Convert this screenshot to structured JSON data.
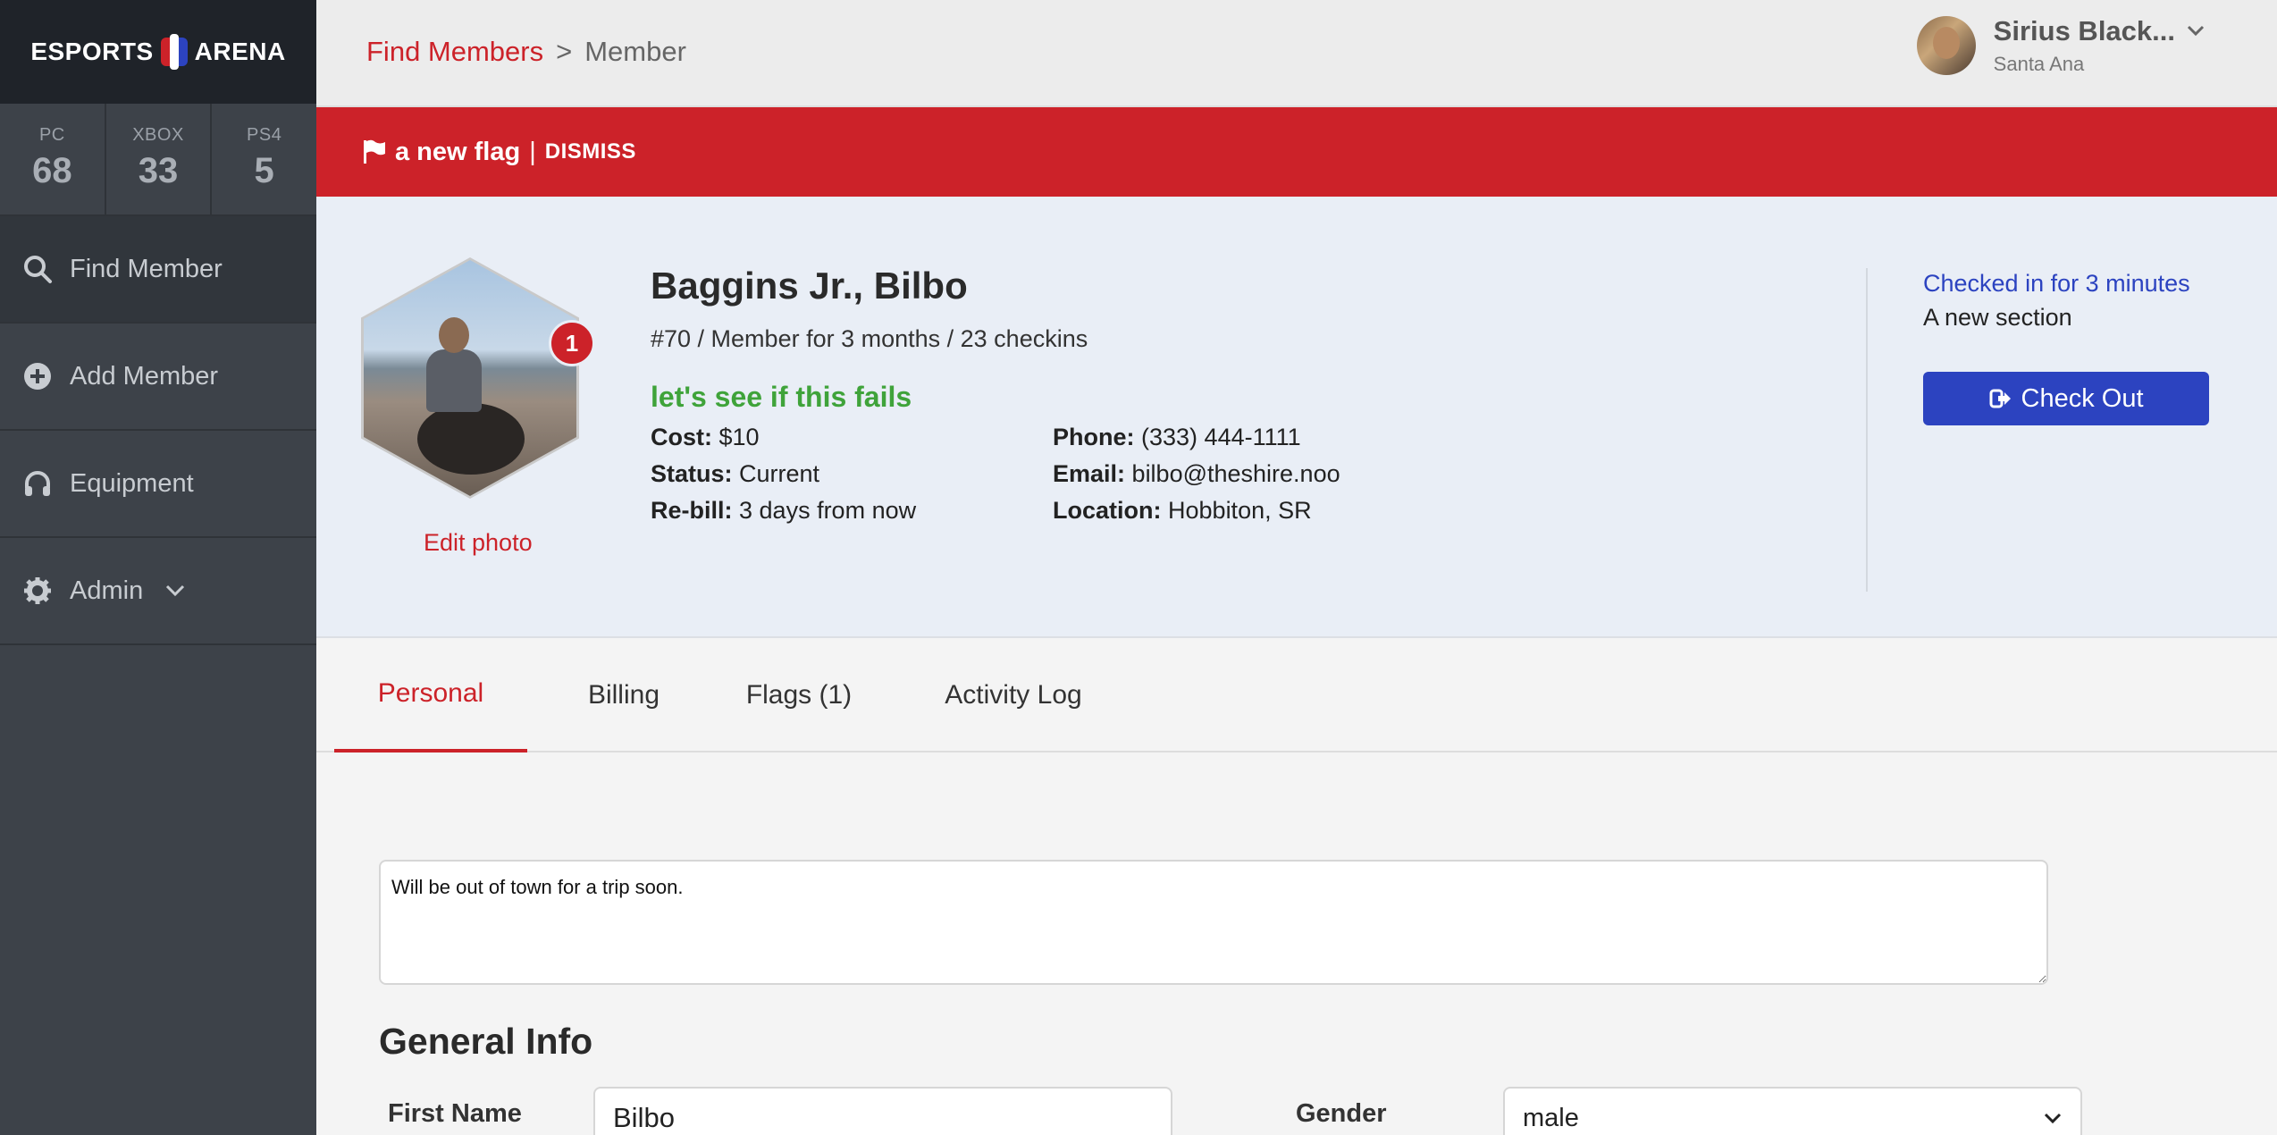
{
  "brand": {
    "left": "ESPORTS",
    "right": "ARENA"
  },
  "counts": [
    {
      "label": "PC",
      "value": "68"
    },
    {
      "label": "XBOX",
      "value": "33"
    },
    {
      "label": "PS4",
      "value": "5"
    }
  ],
  "nav": [
    {
      "label": "Find Member",
      "icon": "search-icon"
    },
    {
      "label": "Add Member",
      "icon": "plus-circle-icon"
    },
    {
      "label": "Equipment",
      "icon": "headset-icon"
    },
    {
      "label": "Admin",
      "icon": "gear-icon"
    }
  ],
  "breadcrumb": {
    "link": "Find Members",
    "sep": ">",
    "current": "Member"
  },
  "user": {
    "name": "Sirius Black...",
    "location": "Santa Ana"
  },
  "banner": {
    "text": "a new flag",
    "sep": "|",
    "dismiss": "DISMISS"
  },
  "member": {
    "name": "Baggins Jr., Bilbo",
    "summary": "#70 / Member for 3 months / 23 checkins",
    "note": "let's see if this fails",
    "flag_count": "1",
    "edit_photo": "Edit photo",
    "cost_label": "Cost:",
    "cost": "$10",
    "status_label": "Status:",
    "status": "Current",
    "rebill_label": "Re-bill:",
    "rebill": "3 days from now",
    "phone_label": "Phone:",
    "phone": "(333) 444-1111",
    "email_label": "Email:",
    "email": "bilbo@theshire.noo",
    "location_label": "Location:",
    "location": "Hobbiton, SR",
    "checked_in": "Checked in for 3 minutes",
    "section": "A new section",
    "checkout": "Check Out"
  },
  "tabs": [
    "Personal",
    "Billing",
    "Flags (1)",
    "Activity Log"
  ],
  "content": {
    "notes": "Will be out of town for a trip soon.",
    "general_info": "General Info",
    "first_name_label": "First Name",
    "first_name": "Bilbo",
    "gender_label": "Gender",
    "gender": "male"
  },
  "colors": {
    "accent": "#cc2229",
    "primary": "#2c43c0",
    "success": "#3fa33a",
    "sidebar": "#3d4249"
  }
}
